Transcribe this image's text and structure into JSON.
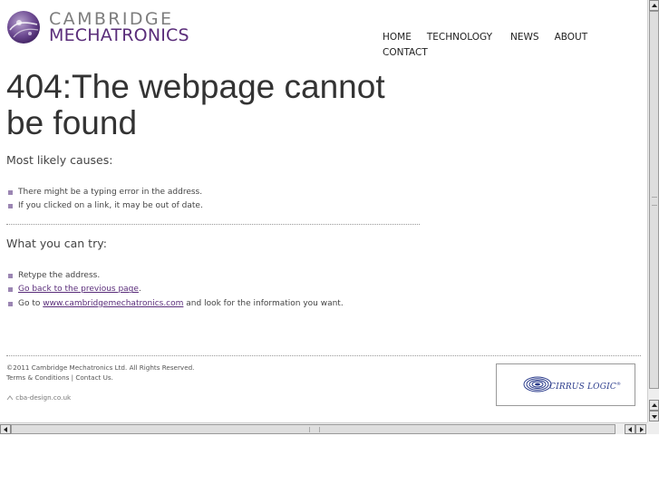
{
  "logo": {
    "line1": "CAMBRIDGE",
    "line2": "MECHATRONICS",
    "colors": {
      "grey": "#7d7d7d",
      "purple": "#5a2d7a"
    }
  },
  "nav": {
    "items": [
      {
        "label": "HOME"
      },
      {
        "label": "TECHNOLOGY"
      },
      {
        "label": "NEWS"
      },
      {
        "label": "ABOUT"
      },
      {
        "label": "CONTACT"
      }
    ]
  },
  "main": {
    "title": "404:The webpage cannot be found",
    "causes_title": "Most likely causes:",
    "causes": [
      "There might be a typing error in the address.",
      "If you clicked on a link, it may be out of date."
    ],
    "try_title": "What you can try:",
    "try_items": {
      "retype": "Retype the address.",
      "go_back_link": "Go back to the previous page",
      "go_back_suffix": ".",
      "goto_prefix": "Go to ",
      "goto_link": "www.cambridgemechatronics.com",
      "goto_suffix": " and look for the information you want."
    }
  },
  "footer": {
    "copyright": "©2011 Cambridge Mechatronics Ltd. All Rights Reserved.",
    "terms": "Terms & Conditions",
    "separator": " | ",
    "contact": "Contact Us.",
    "credit": "cba-design.co.uk"
  },
  "sponsor": {
    "name": "CIRRUS LOGIC",
    "tm": "®",
    "color": "#2b3c8c"
  },
  "icons": {
    "logo_mark": "cambridge-mechatronics-logo-icon",
    "bullet": "square-bullet-icon",
    "credit": "cba-design-icon",
    "sponsor": "cirrus-logic-icon"
  },
  "accent_color": "#9b86b3"
}
